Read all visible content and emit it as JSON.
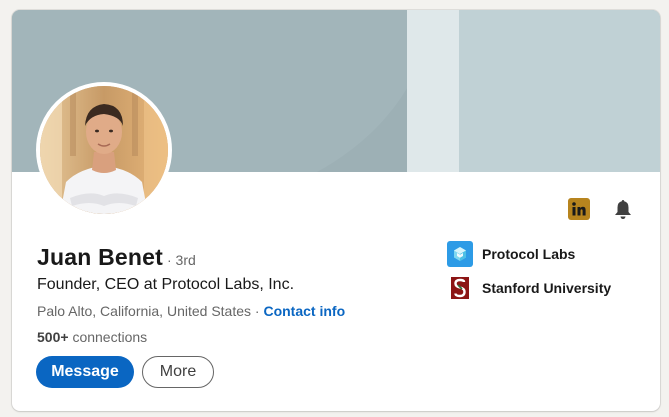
{
  "profile": {
    "name": "Juan Benet",
    "degree": "· 3rd",
    "headline": "Founder, CEO at Protocol Labs, Inc.",
    "location": "Palo Alto, California, United States",
    "location_separator": " · ",
    "contact_label": "Contact info",
    "connections_count": "500+",
    "connections_label": "connections"
  },
  "actions": {
    "message_label": "Message",
    "more_label": "More"
  },
  "organizations": [
    {
      "name": "Protocol Labs",
      "icon": "protocol-labs-logo"
    },
    {
      "name": "Stanford University",
      "icon": "stanford-logo"
    }
  ],
  "icons": {
    "linkedin": "linkedin-icon",
    "notifications": "bell-icon"
  },
  "colors": {
    "accent": "#0a66c2",
    "linkedin_badge": "#b7841e",
    "stanford": "#8c1515",
    "protocol_labs": "#2d9be6",
    "banner": "#9db0b5"
  }
}
